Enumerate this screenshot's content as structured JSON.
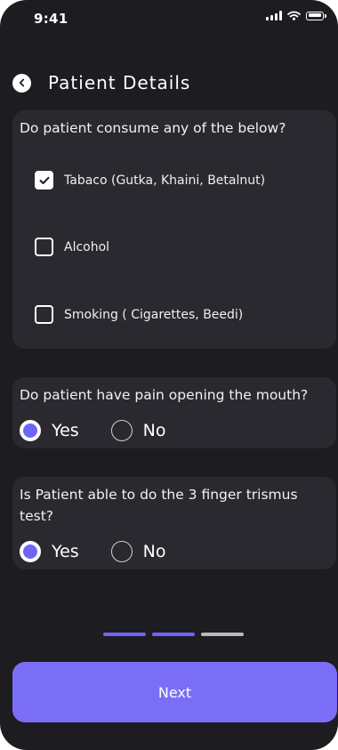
{
  "status_bar": {
    "time": "9:41",
    "icons": [
      "cellular-signal-icon",
      "wifi-icon",
      "battery-icon"
    ]
  },
  "header": {
    "back_icon": "chevron-left-icon",
    "title": "Patient Details"
  },
  "consumption": {
    "question": "Do patient consume any of the below?",
    "options": [
      {
        "label": "Tabaco (Gutka, Khaini, Betalnut)",
        "checked": true
      },
      {
        "label": "Alcohol",
        "checked": false
      },
      {
        "label": "Smoking ( Cigarettes, Beedi)",
        "checked": false
      }
    ]
  },
  "mouth_pain": {
    "question": "Do patient have pain opening the mouth?",
    "options": [
      {
        "label": "Yes",
        "selected": true
      },
      {
        "label": "No",
        "selected": false
      }
    ]
  },
  "trismus_test": {
    "question": "Is Patient able to do the 3 finger trismus test?",
    "options": [
      {
        "label": "Yes",
        "selected": true
      },
      {
        "label": "No",
        "selected": false
      }
    ]
  },
  "pager": {
    "total_steps": 3,
    "completed_steps": 2
  },
  "next_button": {
    "label": "Next"
  },
  "colors": {
    "background": "#1d1c20",
    "card": "#2a2930",
    "accent": "#7b6ef6",
    "radio_dot": "#6f65f5",
    "pager_active": "#6f65f5",
    "pager_inactive": "#b9b9b9"
  }
}
